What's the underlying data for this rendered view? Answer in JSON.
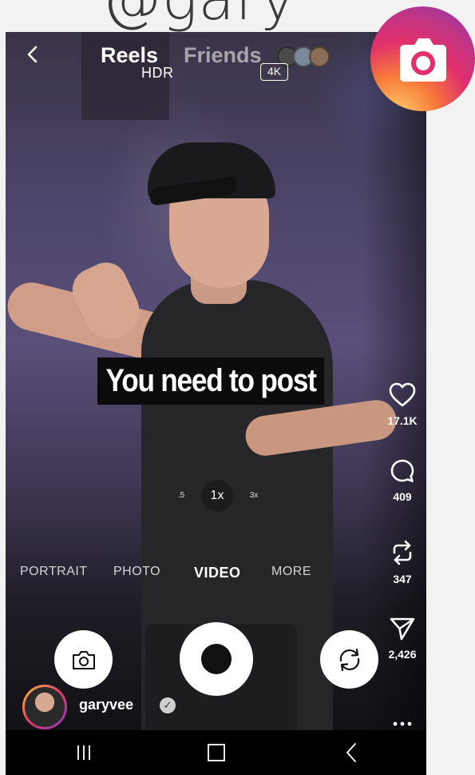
{
  "handle_fragment": "@gary",
  "header": {
    "tab_reels": "Reels",
    "tab_friends": "Friends",
    "hdr": "HDR",
    "resolution_badge": "4K"
  },
  "caption": "You need to post",
  "actions": {
    "likes": "17.1K",
    "comments": "409",
    "reposts": "347",
    "shares": "2,426"
  },
  "zoom": {
    "options": [
      ".5",
      "1x",
      "3x"
    ],
    "selected": "1x"
  },
  "camera_modes": [
    "PORTRAIT",
    "PHOTO",
    "VIDEO",
    "MORE"
  ],
  "active_mode": "VIDEO",
  "author": {
    "username": "garyvee",
    "verified": true
  },
  "icons": {
    "back": "back-icon",
    "like": "heart-icon",
    "comment": "comment-icon",
    "repost": "repost-icon",
    "share": "send-icon",
    "more": "more-icon",
    "camera": "camera-icon",
    "switch": "switch-camera-icon",
    "instagram": "instagram-logo-icon"
  },
  "colors": {
    "caption_bg": "#0b0b0b",
    "caption_text": "#ffffff",
    "page_bg": "#f2f2f2",
    "instagram_gradient": [
      "#fdd26a",
      "#f7793a",
      "#e1306c",
      "#c13584",
      "#833ab4"
    ]
  }
}
